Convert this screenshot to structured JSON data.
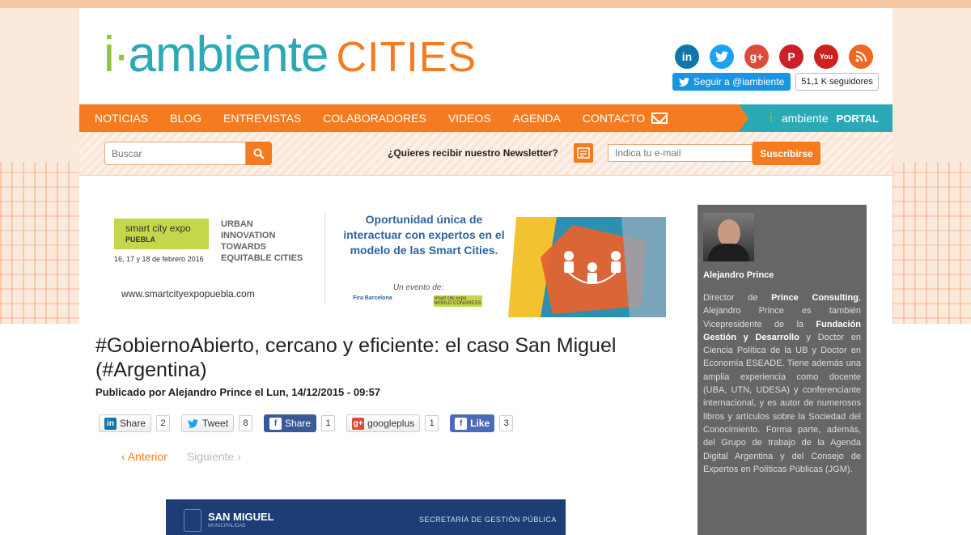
{
  "logo": {
    "i": "i·",
    "ambiente": "ambiente",
    "cities": "CITIES"
  },
  "socials": [
    {
      "name": "linkedin-icon",
      "glyph": "in"
    },
    {
      "name": "twitter-icon",
      "glyph": "t"
    },
    {
      "name": "googleplus-icon",
      "glyph": "g+"
    },
    {
      "name": "pinterest-icon",
      "glyph": "P"
    },
    {
      "name": "youtube-icon",
      "glyph": "You"
    },
    {
      "name": "rss-icon",
      "glyph": "))"
    }
  ],
  "twitter_follow": {
    "label": "Seguir a @iambiente",
    "count": "51,1 K seguidores"
  },
  "nav": {
    "items": [
      "NOTICIAS",
      "BLOG",
      "ENTREVISTAS",
      "COLABORADORES",
      "VIDEOS",
      "AGENDA",
      "CONTACTO"
    ],
    "portal": {
      "i": "i·",
      "ambiente": "ambiente",
      "label": "PORTAL"
    }
  },
  "search": {
    "placeholder": "Buscar"
  },
  "newsletter": {
    "label": "¿Quieres recibir nuestro Newsletter?",
    "email_placeholder": "Indica tu e-mail",
    "subscribe_label": "Suscribirse"
  },
  "banner": {
    "logo_main": "smart city expo",
    "logo_city": "PUEBLA",
    "dates": "16, 17 y 18 de febrero 2016",
    "urban": "URBAN INNOVATION TOWARDS EQUITABLE CITIES",
    "url": "www.smartcityexpopuebla.com",
    "headline": "Oportunidad única de interactuar con expertos en el modelo de las Smart Cities.",
    "event_by": "Un evento de:",
    "fira": "Fira Barcelona",
    "sce": "smart city expo WORLD CONGRESS"
  },
  "article": {
    "title": "#GobiernoAbierto, cercano y eficiente: el caso San Miguel (#Argentina)",
    "meta": "Publicado por Alejandro Prince el Lun, 14/12/2015 - 09:57"
  },
  "share": {
    "linkedin": {
      "label": "Share",
      "count": "2"
    },
    "twitter": {
      "label": "Tweet",
      "count": "8"
    },
    "facebook": {
      "label": "Share",
      "count": "1"
    },
    "googleplus": {
      "label": "googleplus",
      "count": "1"
    },
    "like": {
      "label": "Like",
      "count": "3"
    }
  },
  "pager": {
    "prev": "‹ Anterior",
    "next": "Siguiente ›"
  },
  "article_image": {
    "org": "SAN MIGUEL",
    "org_sub": "MUNICIPALIDAD",
    "section": "SECRETARÍA DE GESTIÓN PÚBLICA"
  },
  "author": {
    "name": "Alejandro Prince",
    "bio_1": "Director de ",
    "bio_b1": "Prince Consulting",
    "bio_2": ", Alejandro Prince es también Vicepresidente de la ",
    "bio_b2": "Fundación Gestión y Desarrollo",
    "bio_3": " y Doctor en Ciencia Política de la UB y Doctor en Economía ESEADE. Tiene además una amplia experiencia como docente (UBA, UTN, UDESA) y conferenciante internacional, y es autor de numerosos libros y artículos sobre la Sociedad del Conocimiento. Forma parte, además, del Grupo de trabajo de la Agenda Digital Argentina y del Consejo de Expertos en Políticas Públicas (JGM)."
  },
  "colors": {
    "orange": "#f47b20",
    "teal": "#2aa9b6",
    "green": "#8cc63f",
    "sidebar": "#666666"
  }
}
